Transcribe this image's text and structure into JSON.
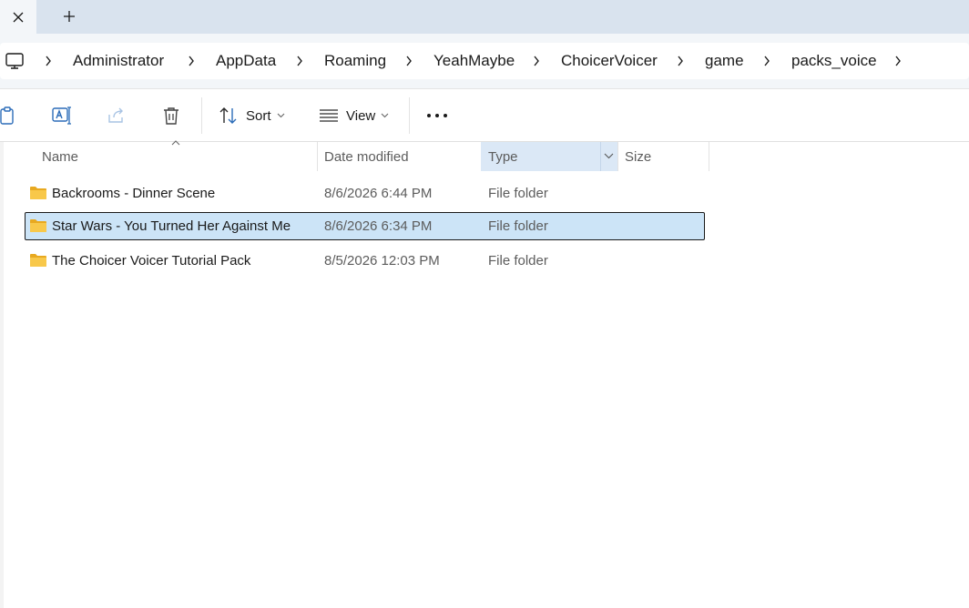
{
  "tabs": {
    "close_glyph": "✕",
    "new_tab_glyph": "+"
  },
  "breadcrumb": {
    "root_icon": "this-pc-icon",
    "items": [
      "Administrator",
      "AppData",
      "Roaming",
      "YeahMaybe",
      "ChoicerVoicer",
      "game",
      "packs_voice"
    ]
  },
  "toolbar": {
    "icons": [
      "clipboard-icon",
      "rename-icon",
      "share-icon",
      "delete-icon"
    ],
    "sort_label": "Sort",
    "view_label": "View",
    "more_glyph": "•••"
  },
  "columns": {
    "name": "Name",
    "date": "Date modified",
    "type": "Type",
    "size": "Size"
  },
  "files": [
    {
      "name": "Backrooms - Dinner Scene",
      "date": "8/6/2026 6:44 PM",
      "type": "File folder",
      "selected": false
    },
    {
      "name": "Star Wars - You Turned Her Against Me",
      "date": "8/6/2026 6:34 PM",
      "type": "File folder",
      "selected": true
    },
    {
      "name": "The Choicer Voicer Tutorial Pack",
      "date": "8/5/2026 12:03 PM",
      "type": "File folder",
      "selected": false
    }
  ],
  "colors": {
    "accent_selection": "#cce4f7",
    "folder_yellow": "#f5c342",
    "tabstrip": "#d9e3ee"
  }
}
